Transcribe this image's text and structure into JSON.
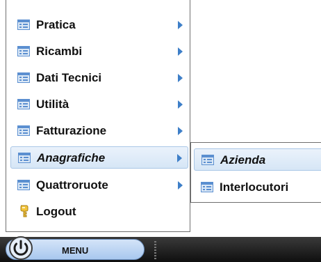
{
  "menu": {
    "items": [
      {
        "label": "Pratica",
        "icon": "window-icon",
        "submenu": true
      },
      {
        "label": "Ricambi",
        "icon": "window-icon",
        "submenu": true
      },
      {
        "label": "Dati Tecnici",
        "icon": "window-icon",
        "submenu": true
      },
      {
        "label": "Utilità",
        "icon": "window-icon",
        "submenu": true
      },
      {
        "label": "Fatturazione",
        "icon": "window-icon",
        "submenu": true
      },
      {
        "label": "Anagrafiche",
        "icon": "window-icon",
        "submenu": true,
        "active": true
      },
      {
        "label": "Quattroruote",
        "icon": "window-icon",
        "submenu": true
      },
      {
        "label": "Logout",
        "icon": "key-icon",
        "submenu": false
      }
    ]
  },
  "submenu": {
    "items": [
      {
        "label": "Azienda",
        "icon": "window-icon",
        "active": true
      },
      {
        "label": "Interlocutori",
        "icon": "window-icon"
      }
    ]
  },
  "taskbar": {
    "start_label": "MENU",
    "power_icon": "power-icon"
  },
  "colors": {
    "accent": "#3e7fc8",
    "highlight": "#d6e6f6",
    "taskbar": "#1a1a1a"
  }
}
